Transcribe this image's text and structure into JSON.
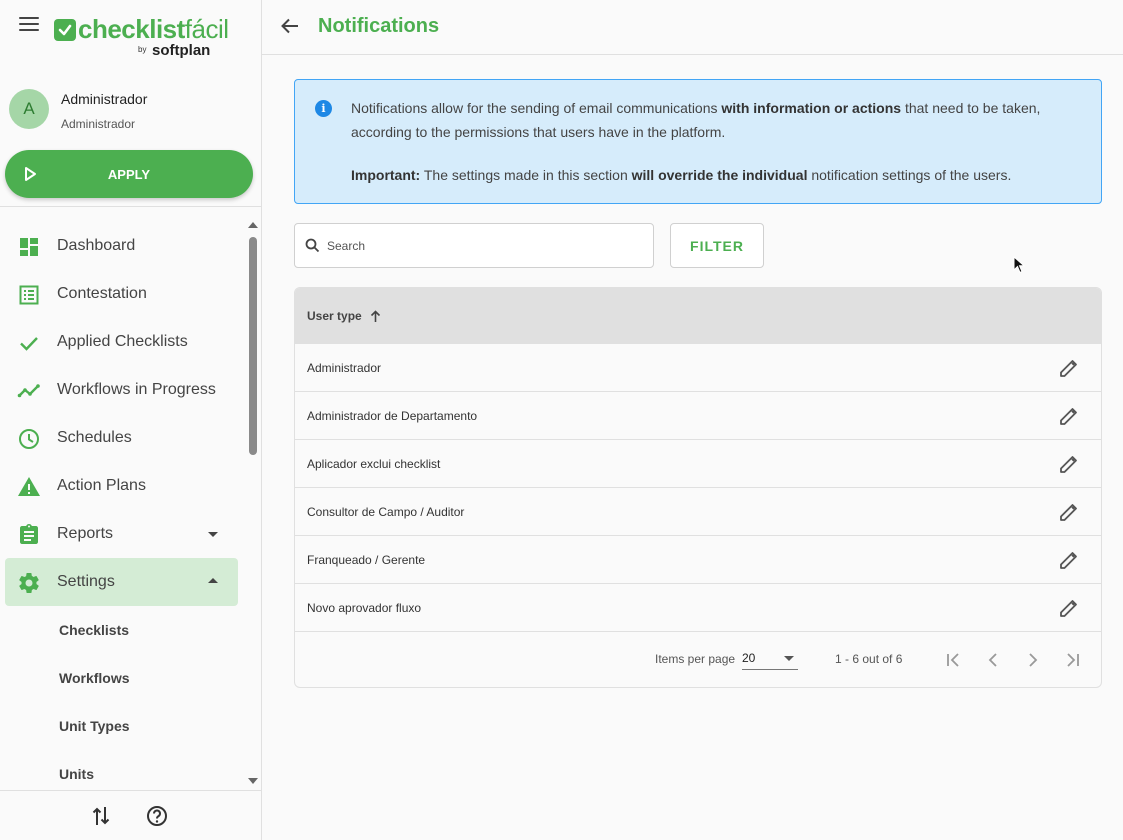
{
  "brand": {
    "name_main": "checklist",
    "name_accent": "fácil",
    "by": "by",
    "company": "softplan"
  },
  "user": {
    "initial": "A",
    "name": "Administrador",
    "role": "Administrador"
  },
  "apply_label": "APPLY",
  "nav": {
    "dashboard": "Dashboard",
    "contestation": "Contestation",
    "applied_checklists": "Applied Checklists",
    "workflows_in_progress": "Workflows in Progress",
    "schedules": "Schedules",
    "action_plans": "Action Plans",
    "reports": "Reports",
    "settings": "Settings",
    "sub": [
      "Checklists",
      "Workflows",
      "Unit Types",
      "Units"
    ]
  },
  "header": {
    "title": "Notifications"
  },
  "info": {
    "p1_a": "Notifications allow for the sending of email communications ",
    "p1_b": "with information or actions",
    "p1_c": " that need to be taken, according to the permissions that users have in the platform.",
    "p2_a": "Important:",
    "p2_b": " The settings made in this section ",
    "p2_c": "will override the individual",
    "p2_d": " notification settings of the users."
  },
  "search": {
    "placeholder": "Search",
    "value": ""
  },
  "filter_label": "FILTER",
  "table": {
    "column": "User type",
    "rows": [
      "Administrador",
      "Administrador de Departamento",
      "Aplicador exclui checklist",
      "Consultor de Campo / Auditor",
      "Franqueado / Gerente",
      "Novo aprovador fluxo"
    ]
  },
  "pager": {
    "items_per_page_label": "Items per page",
    "items_per_page": "20",
    "range": "1 - 6 out of 6"
  },
  "colors": {
    "brand_green": "#4caf50",
    "active_bg": "#d4ecd5",
    "info_bg": "#d6ecfb",
    "info_border": "#42a5f5"
  }
}
